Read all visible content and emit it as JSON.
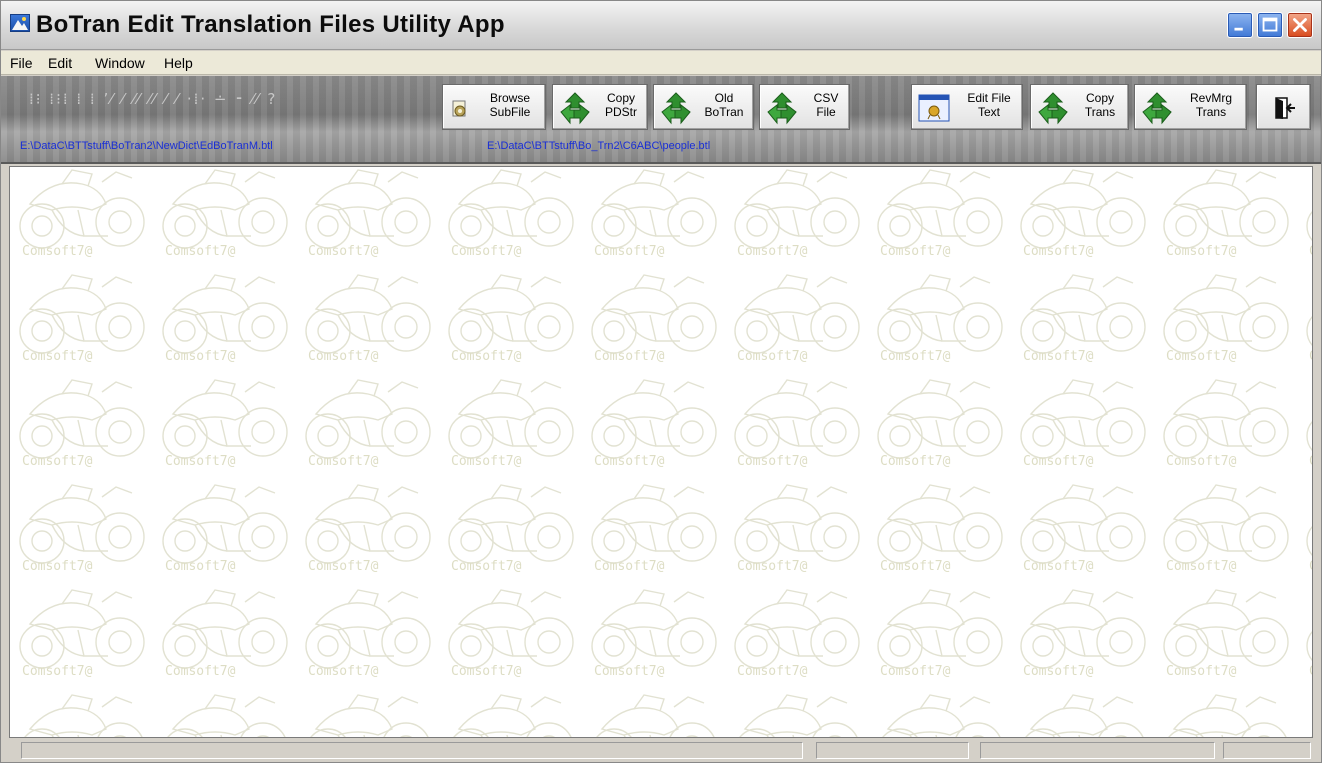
{
  "window": {
    "title": "BoTran Edit Translation Files Utility App",
    "app_icon": "landscape-icon",
    "controls": [
      "minimize-icon",
      "maximize-icon",
      "close-icon"
    ]
  },
  "menu": {
    "items": [
      "File",
      "Edit",
      "Window",
      "Help"
    ]
  },
  "toolbar": {
    "faint_tools": "⁞⁝ ⁞⁝⁞ ⁞ ⁞ ʼ⁄ ⁄ ⁄⁄ ⁄⁄ ⁄ ⁄ ·⁞· ∸ ⁃ ⁄⁄ ?",
    "buttons": [
      {
        "label": "Browse\nSubFile",
        "icon": "cog-file-icon"
      },
      {
        "label": "Copy\nPDStr",
        "icon": "recycle-icon"
      },
      {
        "label": "Old\nBoTran",
        "icon": "recycle-icon"
      },
      {
        "label": "CSV\nFile",
        "icon": "recycle-icon"
      },
      {
        "label": "Edit File\nText",
        "icon": "window-edit-icon"
      },
      {
        "label": "Copy\nTrans",
        "icon": "recycle-icon"
      },
      {
        "label": "RevMrg\nTrans",
        "icon": "recycle-icon"
      },
      {
        "label": "",
        "icon": "exit-door-icon"
      }
    ],
    "path_left": "E:\\DataC\\BTTstuff\\BoTran2\\NewDict\\EdBoTranM.btl",
    "path_right": "E:\\DataC\\BTTstuff\\Bo_Trn2\\C6ABC\\people.btl"
  },
  "background": {
    "watermark_text": "Comsoft7@",
    "watermark_image": "motorcycle-sidecar-icon"
  },
  "colors": {
    "path_text": "#1a2fd6",
    "recycle_green": "#2f8f2f",
    "watermark": "#ddddc4"
  }
}
